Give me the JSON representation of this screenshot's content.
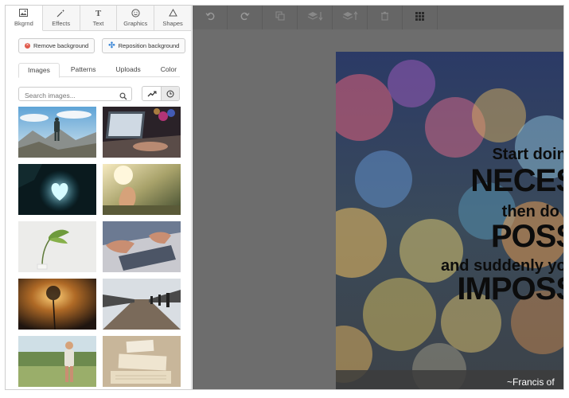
{
  "tabs": [
    {
      "label": "Bkgrnd",
      "icon": "image-icon",
      "active": true
    },
    {
      "label": "Effects",
      "icon": "magic-wand-icon",
      "active": false
    },
    {
      "label": "Text",
      "icon": "text-T-icon",
      "active": false
    },
    {
      "label": "Graphics",
      "icon": "smiley-icon",
      "active": false
    },
    {
      "label": "Shapes",
      "icon": "triangle-icon",
      "active": false
    }
  ],
  "actions": {
    "remove_label": "Remove background",
    "reposition_label": "Reposition background"
  },
  "subtabs": [
    {
      "label": "Images",
      "active": true
    },
    {
      "label": "Patterns",
      "active": false
    },
    {
      "label": "Uploads",
      "active": false
    },
    {
      "label": "Color",
      "active": false
    }
  ],
  "search": {
    "placeholder": "Search images..."
  },
  "sort_toggle": {
    "trending_icon": "trending-icon",
    "recent_icon": "clock-icon",
    "selected": "recent"
  },
  "thumbnails": [
    {
      "subject": "hiker on mountain"
    },
    {
      "subject": "laptop typing"
    },
    {
      "subject": "heart cave"
    },
    {
      "subject": "hand holding sun"
    },
    {
      "subject": "plant leaf"
    },
    {
      "subject": "hands on laptop"
    },
    {
      "subject": "dandelion sunset"
    },
    {
      "subject": "people on bridge"
    },
    {
      "subject": "child in field"
    },
    {
      "subject": "books and papers"
    }
  ],
  "toolbar": [
    {
      "icon": "undo-icon"
    },
    {
      "icon": "redo-icon"
    },
    {
      "icon": "duplicate-icon"
    },
    {
      "icon": "layer-down-icon"
    },
    {
      "icon": "layer-up-icon"
    },
    {
      "icon": "trash-icon"
    },
    {
      "icon": "grid-icon"
    }
  ],
  "poster": {
    "lines": [
      "Start doing",
      "NECES",
      "then do w",
      "POSS",
      "and suddenly you",
      "IMPOSS"
    ],
    "credit": "~Francis of"
  },
  "colors": {
    "toolbar_bg": "#666666",
    "canvas_bg": "#6d6d6d",
    "accent_red": "#e05a4c",
    "accent_blue": "#3a86d6"
  }
}
